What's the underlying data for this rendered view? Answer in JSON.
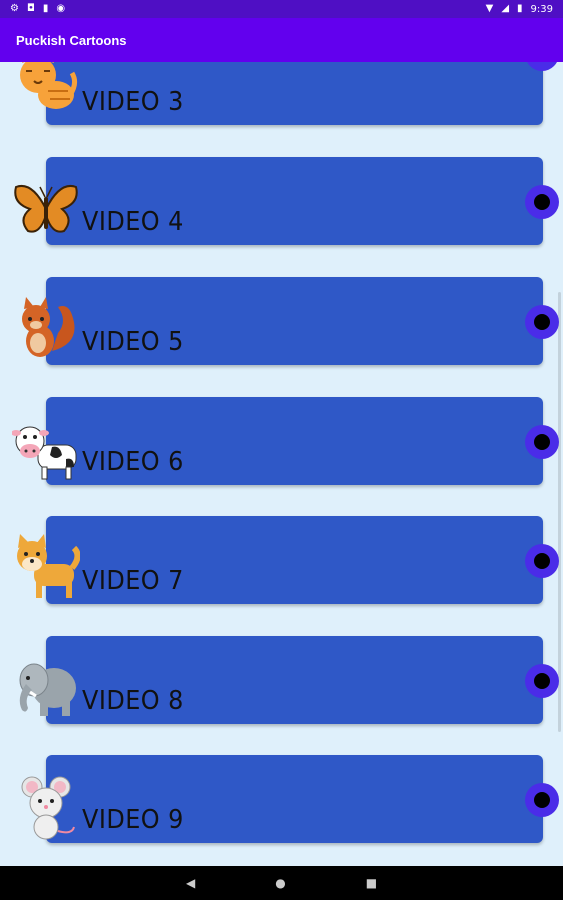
{
  "status_bar": {
    "time": "9:39"
  },
  "app_bar": {
    "title": "Puckish Cartoons"
  },
  "videos": [
    {
      "label": "VIDEO 3",
      "icon": "cat-icon"
    },
    {
      "label": "VIDEO 4",
      "icon": "butterfly-icon"
    },
    {
      "label": "VIDEO 5",
      "icon": "squirrel-icon"
    },
    {
      "label": "VIDEO 6",
      "icon": "cow-icon"
    },
    {
      "label": "VIDEO 7",
      "icon": "dog-icon"
    },
    {
      "label": "VIDEO 8",
      "icon": "elephant-icon"
    },
    {
      "label": "VIDEO 9",
      "icon": "mouse-icon"
    }
  ],
  "colors": {
    "app_bar": "#6200ee",
    "status_bar": "#4f0fc4",
    "card": "#2f58c7",
    "background": "#dff0fb",
    "play_outer": "#4a2ce8"
  },
  "nav": {
    "back": "◀",
    "home": "●",
    "recents": "■"
  }
}
